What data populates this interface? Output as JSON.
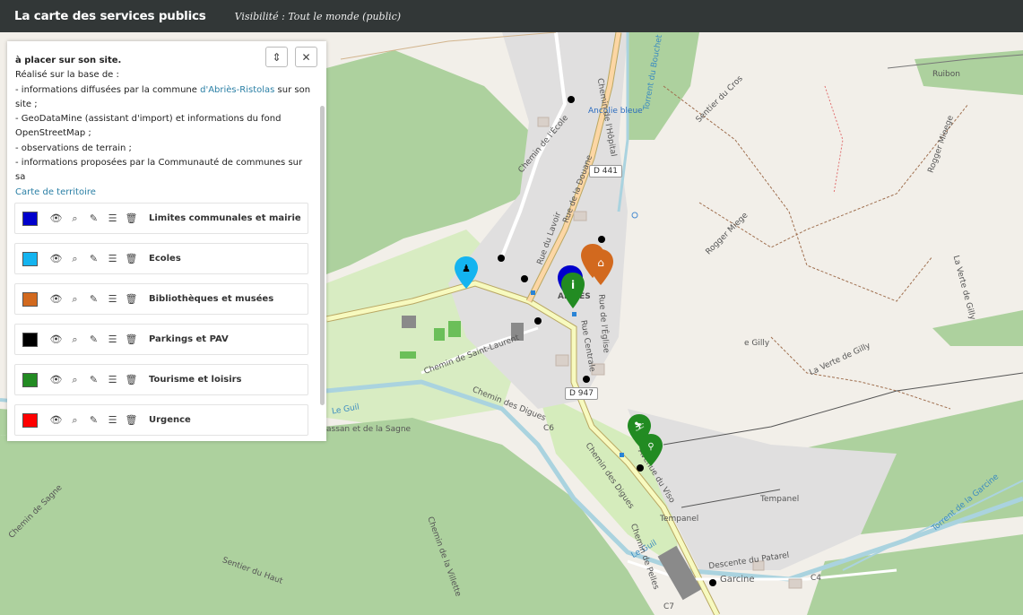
{
  "header": {
    "title": "La carte des services publics",
    "visibility": "Visibilité : Tout le monde (public)"
  },
  "panel": {
    "intro_cut": "à placer sur son site.",
    "based_on": "Réalisé sur la base de :",
    "line1_prefix": "- informations diffusées par la commune ",
    "line1_link": "d'Abriès-Ristolas",
    "line1_suffix": " sur son site ;",
    "line2": "- GeoDataMine (assistant d'import) et informations du fond OpenStreetMap ;",
    "line3": "- observations de terrain ;",
    "line4": "- informations proposées par la Communauté de communes sur sa",
    "line4_link": "Carte de territoire",
    "layers": [
      {
        "name": "Limites communales et mairie",
        "color": "#0000cc"
      },
      {
        "name": "Ecoles",
        "color": "#14b4f0"
      },
      {
        "name": "Bibliothèques et musées",
        "color": "#d2691e"
      },
      {
        "name": "Parkings et PAV",
        "color": "#000000"
      },
      {
        "name": "Tourisme et loisirs",
        "color": "#228b22"
      },
      {
        "name": "Urgence",
        "color": "#ff0000"
      }
    ]
  },
  "map": {
    "labels": {
      "ancolie": "Ancolie bleue",
      "ruibon": "Ruibon",
      "d441": "D 441",
      "d947": "D 947",
      "chemin_saint_laurent": "Chemin de Saint-Laurent",
      "chemin_des_digues": "Chemin des Digues",
      "chemin_des_digues2": "Chemin des Digues",
      "le_guil": "Le Guil",
      "le_guil2": "Le Guil",
      "tempanel": "Tempanel",
      "tempanel2": "Tempanel",
      "garcine": "Garcine",
      "descente_patarel": "Descente du Patarel",
      "avenue_viso": "Avenue du Viso",
      "rue_centrale": "Rue Centrale",
      "rue_eglise": "Rue de l'Église",
      "rue_lavour": "Rue du Lavoir",
      "rue_douane": "Rue de la Douane",
      "chemin_hopital": "Chemin de l'Hôpital",
      "chemin_ecole": "Chemin de l'École",
      "chemin_sagne": "Chemin de Sagne",
      "chemin_la_villette": "Chemin de la Villette",
      "sentier_haut": "Sentier du Haut",
      "chemin_pelles": "Chemin de Pelles",
      "sentier_cros": "Sentier du Cros",
      "rogger_mieege": "Rogger Mieege",
      "rogger_miege2": "Rogger Miege",
      "la_verte_gilly": "La Verte de Gilly",
      "la_verte_gilly2": "La Verte de Gilly",
      "le_gilly": "e Gilly",
      "torrent_bouchet": "Torrent du Bouchet",
      "torrent_garcine": "Torrent de la Garcine",
      "c6": "C6",
      "c7": "C7",
      "c4": "C4",
      "sassan": "assan et de la Sagne",
      "abries": "ABRIÈS"
    },
    "colors": {
      "forest": "#add19e",
      "meadow": "#cdebb0",
      "water": "#aad3df",
      "residential": "#e0dfdf",
      "road_primary": "#f7fabf",
      "road_secondary": "#fcd6a4"
    },
    "markers": [
      {
        "name": "school-marker",
        "icon": "school",
        "color": "#14b4f0"
      },
      {
        "name": "info-marker",
        "icon": "info",
        "color": "#228b22"
      },
      {
        "name": "town-hall-marker",
        "icon": "town-hall",
        "color": "#0000cc"
      },
      {
        "name": "museum-marker",
        "icon": "museum",
        "color": "#d2691e"
      },
      {
        "name": "library-marker",
        "icon": "library",
        "color": "#d2691e"
      },
      {
        "name": "skiing-marker",
        "icon": "skiing",
        "color": "#228b22"
      },
      {
        "name": "bike-marker",
        "icon": "bike",
        "color": "#228b22"
      }
    ]
  }
}
